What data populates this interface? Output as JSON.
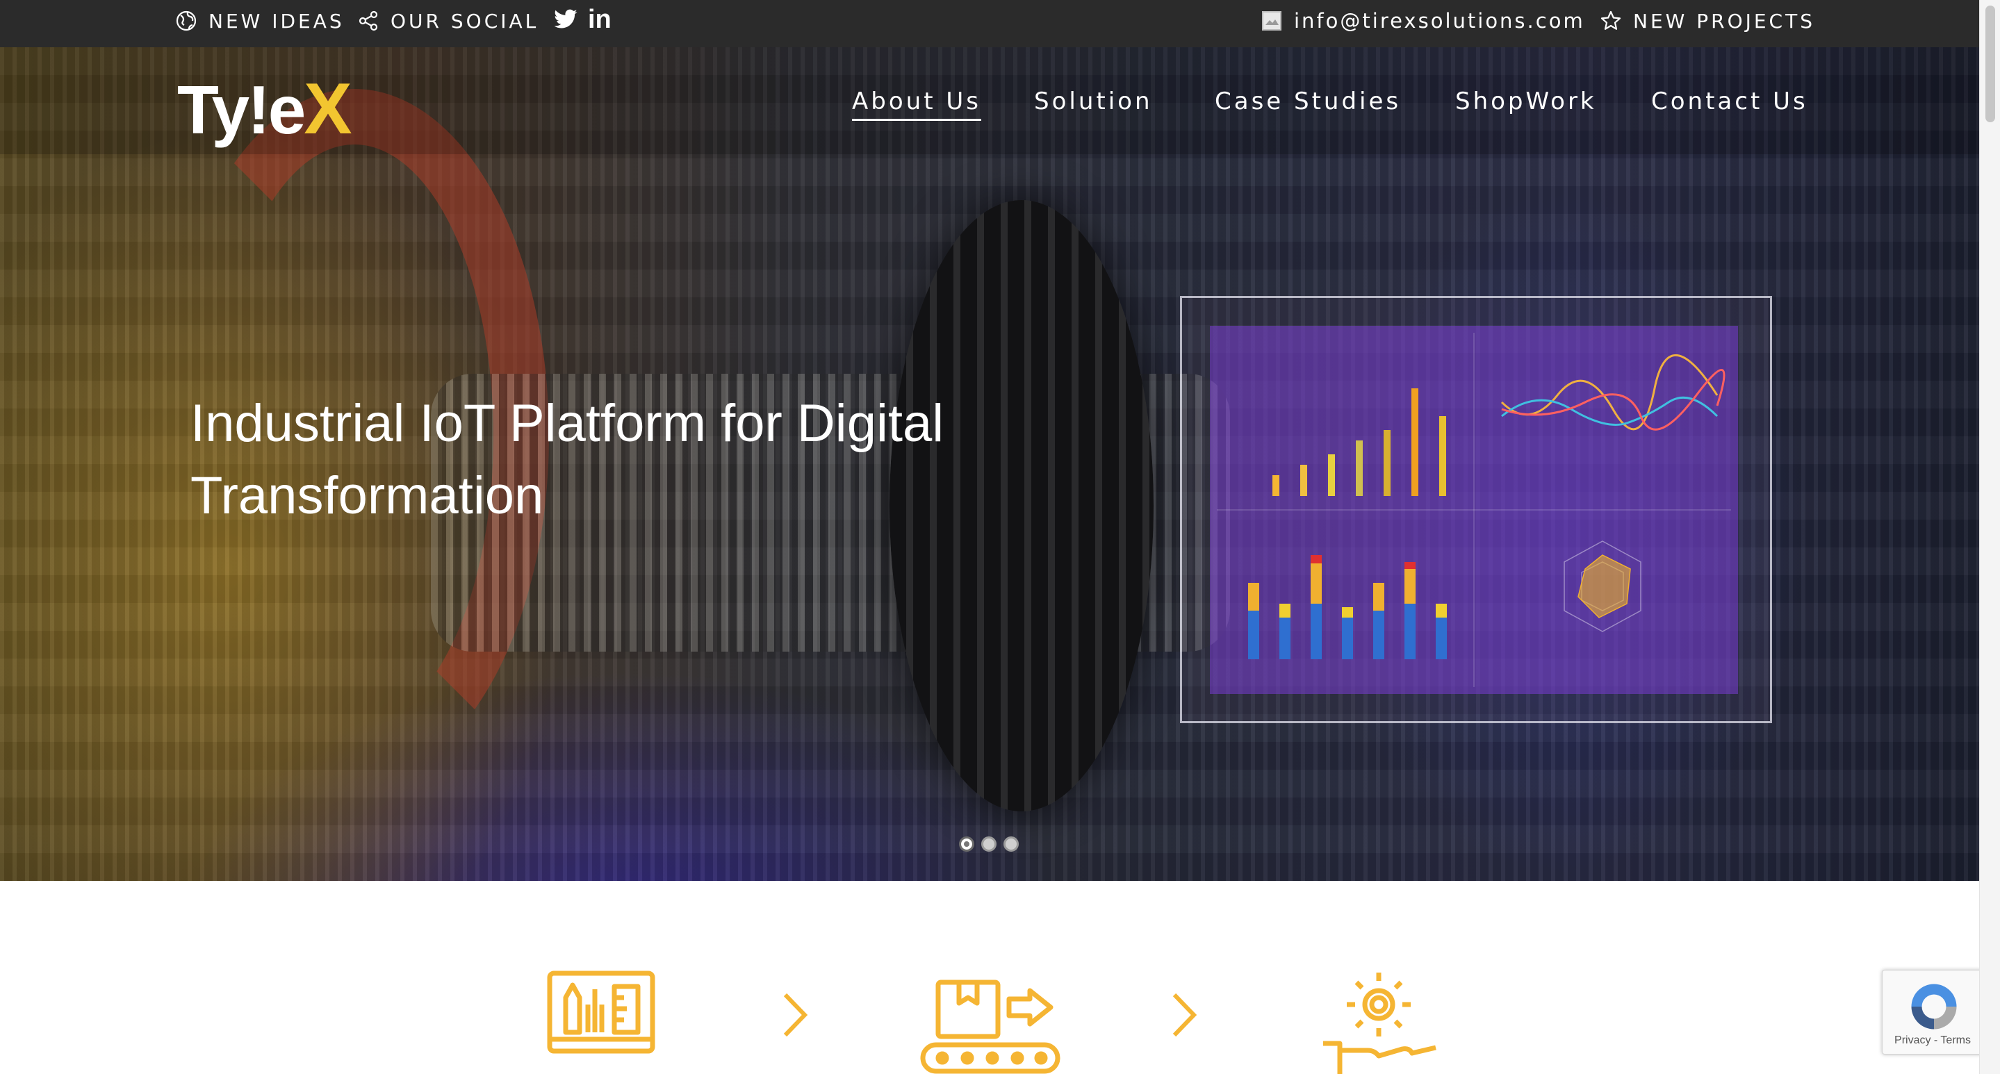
{
  "topbar": {
    "new_ideas": "NEW IDEAS",
    "our_social": "OUR SOCIAL",
    "email": "info@tirexsolutions.com",
    "new_projects": "NEW PROJECTS",
    "icons": [
      "globe-icon",
      "share-icon",
      "twitter-icon",
      "linkedin-icon",
      "email-icon",
      "star-icon"
    ],
    "linkedin_glyph": "in"
  },
  "header": {
    "logo_main": "Ty!e",
    "logo_accent": "X",
    "nav": [
      "About Us",
      "Solution",
      "Case Studies",
      "ShopWork",
      "Contact Us"
    ],
    "active_nav": "About Us"
  },
  "hero": {
    "headline_line1": "Industrial IoT Platform for Digital",
    "headline_line2": "Transformation",
    "slides": 3,
    "active_slide": 1,
    "dashboard_panels": [
      "Bar Chart",
      "Stacked Area Chart",
      "Stacked Bar Chart",
      "Radar Chart"
    ]
  },
  "process": {
    "icons": [
      "design-monitor-icon",
      "chevron-right-icon",
      "conveyor-box-icon",
      "chevron-right-icon",
      "gear-hand-icon"
    ]
  },
  "recaptcha": {
    "label": "Privacy - Terms"
  },
  "colors": {
    "topbar_bg": "#2b2b2b",
    "accent_yellow": "#f2c530",
    "icon_orange": "#f5b533",
    "text_white": "#ffffff"
  }
}
